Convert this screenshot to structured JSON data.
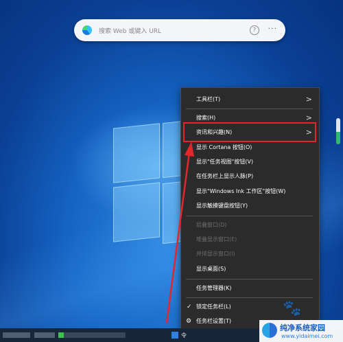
{
  "search": {
    "placeholder": "搜索 Web 或键入 URL",
    "help_glyph": "?",
    "more_glyph": "···"
  },
  "menu": {
    "items": [
      {
        "label": "工具栏(T)",
        "submenu": true,
        "enabled": true
      },
      {
        "label": "搜索(H)",
        "submenu": true,
        "enabled": true
      },
      {
        "label": "资讯和兴趣(N)",
        "submenu": true,
        "enabled": true,
        "highlighted": true
      },
      {
        "label": "显示 Cortana 按钮(O)",
        "enabled": true
      },
      {
        "label": "显示\"任务视图\"按钮(V)",
        "enabled": true
      },
      {
        "label": "在任务栏上显示人脉(P)",
        "enabled": true
      },
      {
        "label": "显示\"Windows Ink 工作区\"按钮(W)",
        "enabled": true
      },
      {
        "label": "显示触摸键盘按钮(Y)",
        "enabled": true
      },
      {
        "label": "层叠窗口(D)",
        "enabled": false
      },
      {
        "label": "堆叠显示窗口(E)",
        "enabled": false
      },
      {
        "label": "并排显示窗口(I)",
        "enabled": false
      },
      {
        "label": "显示桌面(S)",
        "enabled": true
      },
      {
        "label": "任务管理器(K)",
        "enabled": true
      },
      {
        "label": "锁定任务栏(L)",
        "enabled": true,
        "checked": true
      },
      {
        "label": "任务栏设置(T)",
        "enabled": true,
        "icon": "gear-icon"
      }
    ],
    "chevron": ">",
    "check_glyph": "✓",
    "gear_glyph": "⚙"
  },
  "taskbar": {
    "tray_label": "令"
  },
  "watermark": {
    "title": "纯净系统家园",
    "url": "www.yidaimei.com"
  },
  "colors": {
    "highlight_border": "#e1272b",
    "menu_bg": "#2b2b2b",
    "arrow": "#e1272b"
  }
}
